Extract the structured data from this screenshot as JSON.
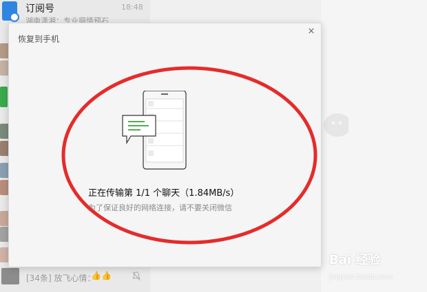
{
  "chat_list": {
    "header": {
      "title": "订阅号",
      "time": "18:48",
      "preview": "湖南潇湘：专业摄情预石"
    },
    "bottom": {
      "count": "[34条] 放飞心情：",
      "emoji": "👍👍"
    }
  },
  "dialog": {
    "title": "恢复到手机",
    "close": "×",
    "status": "正在传输第 1/1 个聊天（1.84MB/s）",
    "hint": "为了保证良好的网络连接，请不要关闭微信"
  },
  "watermark": {
    "text": "Bai 经验",
    "sub": "jingyan.baidu.com"
  },
  "colors": {
    "accent_green": "#4caf50",
    "annotation_red": "#e52b2b",
    "icon_blue": "#2f86e0"
  }
}
